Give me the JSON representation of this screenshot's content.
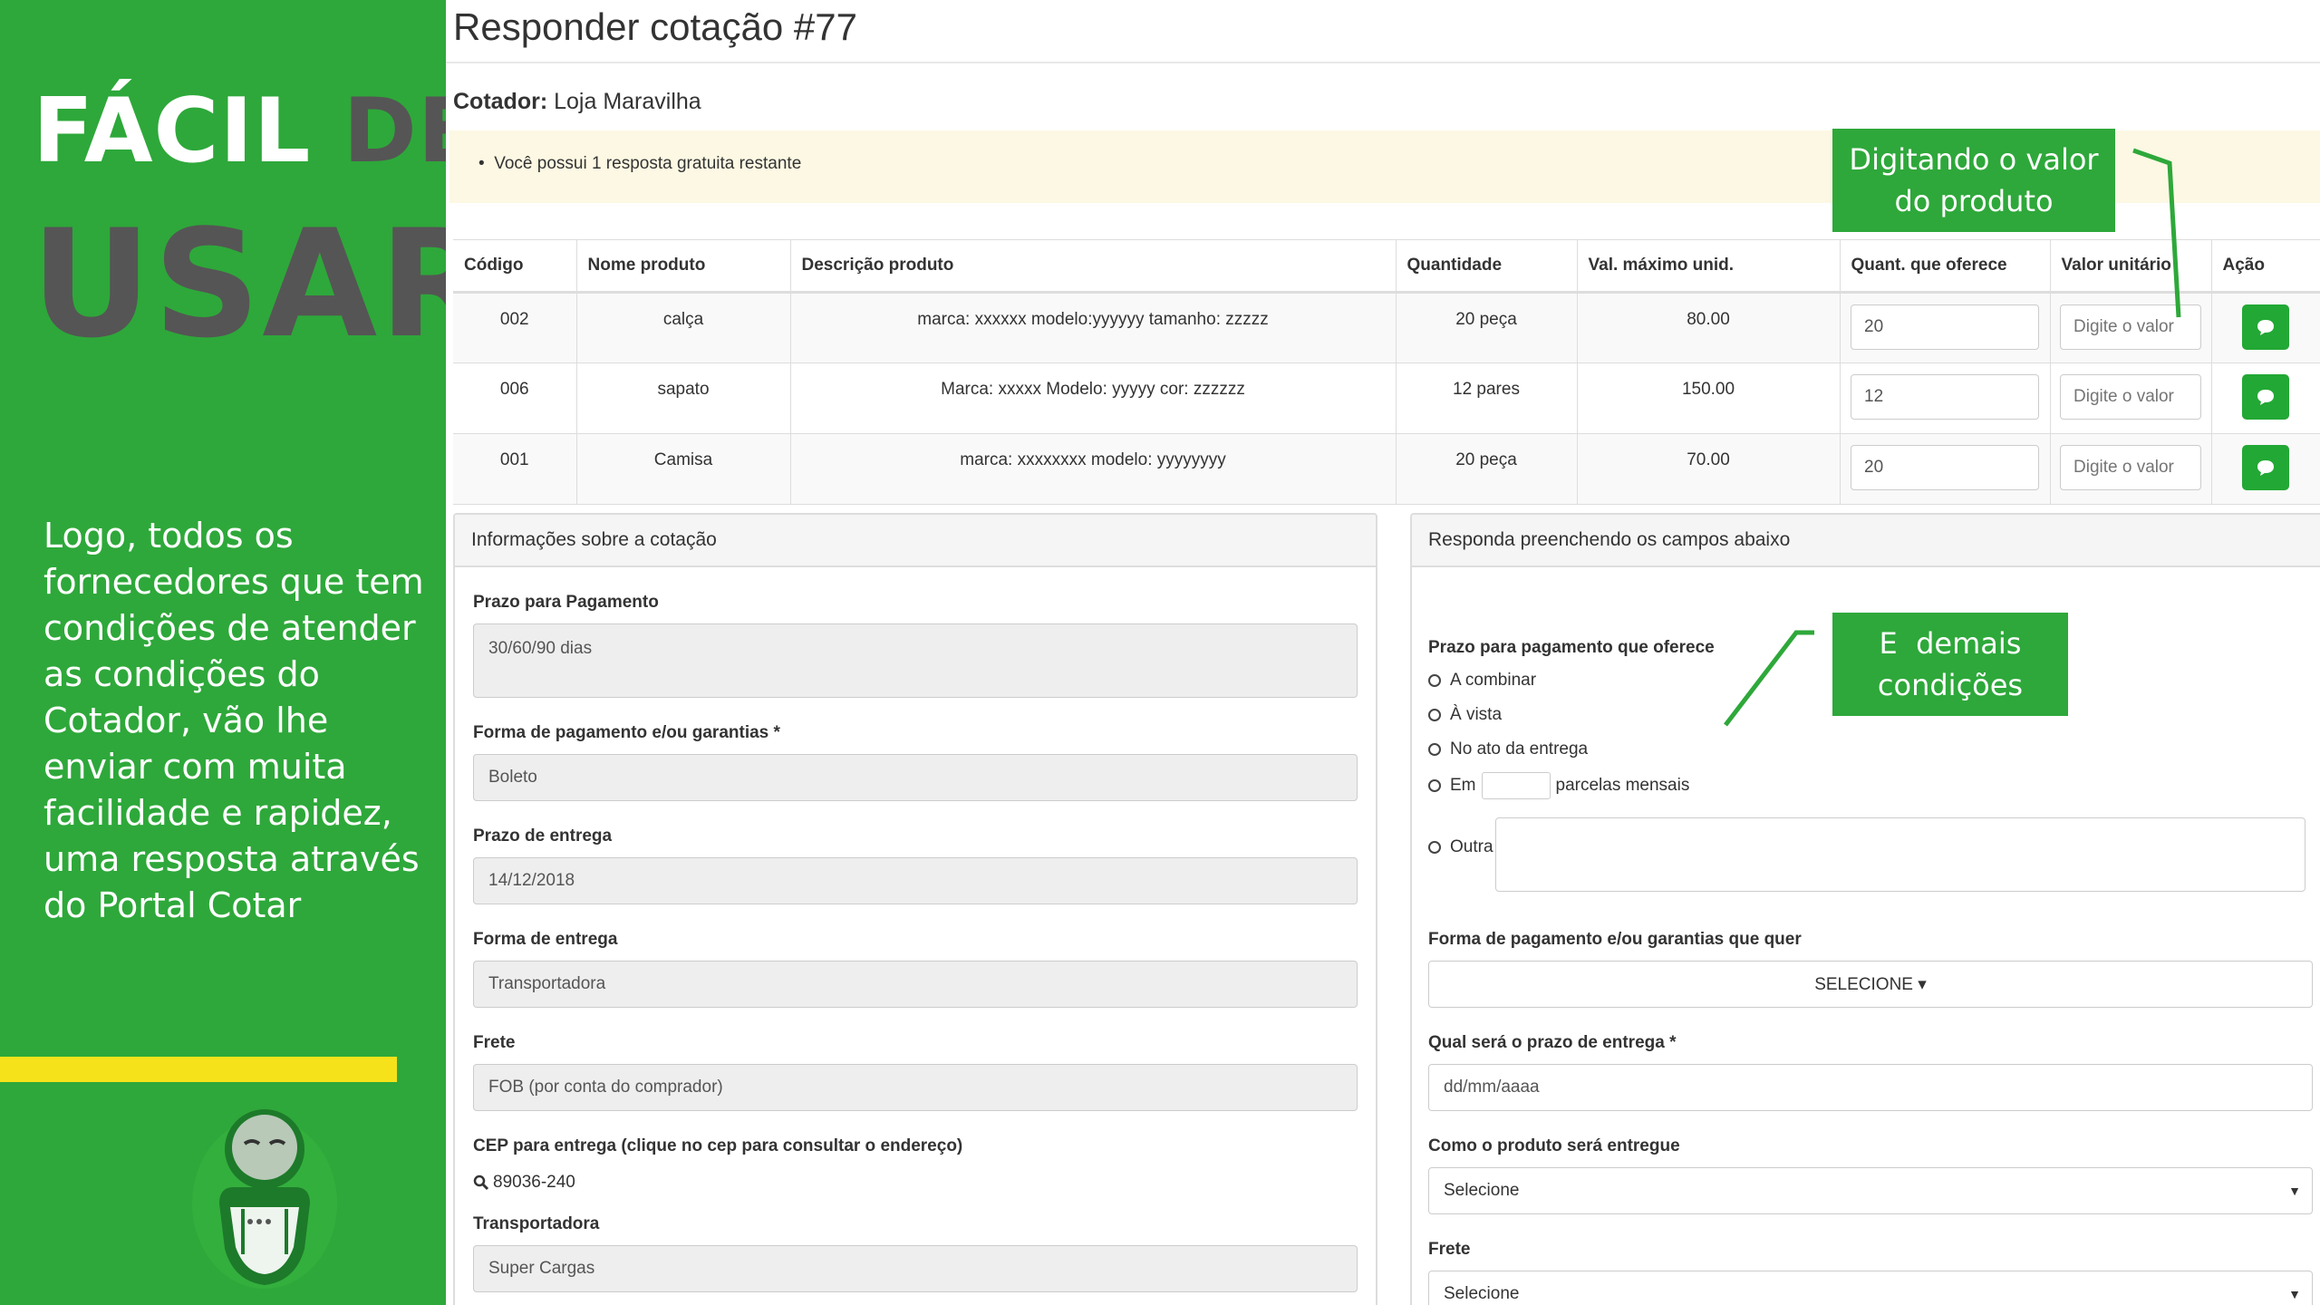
{
  "promo": {
    "heading_word1": "FÁCIL",
    "heading_word2": "DE",
    "heading_word3": "USAR",
    "body": "Logo, todos os fornecedores que tem condições de atender as condições do Cotador, vão lhe enviar com muita facilidade e rapidez, uma resposta através do Portal Cotar",
    "colors": {
      "background": "#2ea83a",
      "accent_bar": "#f5e21a",
      "dark_text": "#555555"
    }
  },
  "page": {
    "title": "Responder cotação #77",
    "cotador_label": "Cotador:",
    "cotador_value": "Loja Maravilha",
    "notice": "Você possui 1 resposta gratuita restante"
  },
  "callouts": {
    "product_value": "Digitando o valor do produto",
    "other_conditions": "E  demais condições"
  },
  "table": {
    "headers": [
      "Código",
      "Nome produto",
      "Descrição produto",
      "Quantidade",
      "Val. máximo unid.",
      "Quant. que oferece",
      "Valor unitário",
      "Ação"
    ],
    "rows": [
      {
        "codigo": "002",
        "nome": "calça",
        "descricao": "marca: xxxxxx modelo:yyyyyy tamanho: zzzzz",
        "quantidade": "20 peça",
        "val_max": "80.00",
        "quant_oferece": "20",
        "valor_placeholder": "Digite o valor"
      },
      {
        "codigo": "006",
        "nome": "sapato",
        "descricao": "Marca: xxxxx Modelo: yyyyy cor: zzzzzz",
        "quantidade": "12 pares",
        "val_max": "150.00",
        "quant_oferece": "12",
        "valor_placeholder": "Digite o valor"
      },
      {
        "codigo": "001",
        "nome": "Camisa",
        "descricao": "marca: xxxxxxxx modelo: yyyyyyyy",
        "quantidade": "20 peça",
        "val_max": "70.00",
        "quant_oferece": "20",
        "valor_placeholder": "Digite o valor"
      }
    ],
    "action_icon": "chat-bubble-icon",
    "action_color": "#22a834"
  },
  "info_panel": {
    "title": "Informações sobre a cotação",
    "prazo_pagamento_label": "Prazo para Pagamento",
    "prazo_pagamento_value": "30/60/90 dias",
    "forma_pagamento_label": "Forma de pagamento e/ou garantias *",
    "forma_pagamento_value": "Boleto",
    "prazo_entrega_label": "Prazo de entrega",
    "prazo_entrega_value": "14/12/2018",
    "forma_entrega_label": "Forma de entrega",
    "forma_entrega_value": "Transportadora",
    "frete_label": "Frete",
    "frete_value": "FOB (por conta do comprador)",
    "cep_label": "CEP para entrega (clique no cep para consultar o endereço)",
    "cep_value": "89036-240",
    "transportadora_label": "Transportadora",
    "transportadora_value": "Super Cargas"
  },
  "response_panel": {
    "title": "Responda preenchendo os campos abaixo",
    "prazo_label": "Prazo para pagamento que oferece",
    "options": {
      "a_combinar": "A combinar",
      "a_vista": "À vista",
      "no_ato": "No ato da entrega",
      "em": "Em",
      "parcelas": "parcelas mensais",
      "outra": "Outra"
    },
    "forma_pagamento_label": "Forma de pagamento e/ou garantias que quer",
    "forma_pagamento_button": "SELECIONE ▾",
    "prazo_entrega_label": "Qual será o prazo de entrega *",
    "prazo_entrega_placeholder": "dd/mm/aaaa",
    "como_entregue_label": "Como o produto será entregue",
    "como_entregue_value": "Selecione",
    "frete_label": "Frete",
    "frete_value": "Selecione"
  }
}
